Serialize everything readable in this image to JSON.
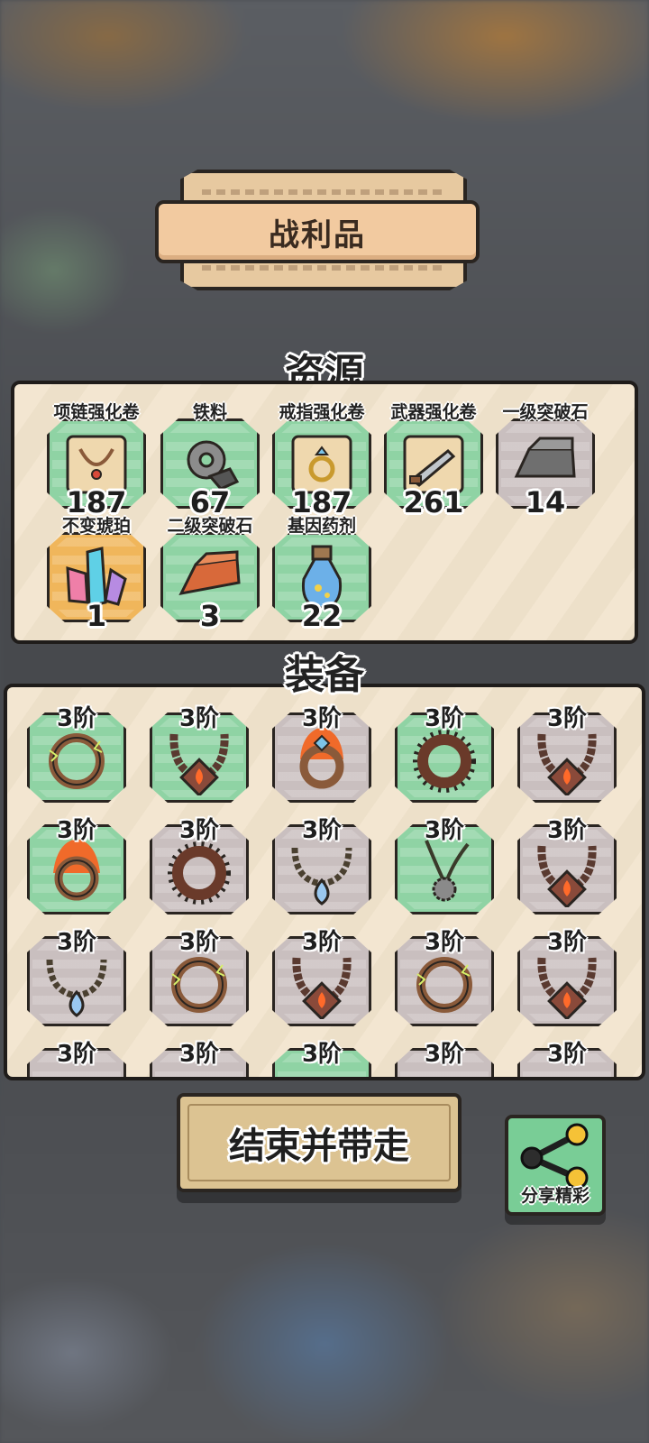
{
  "title": "战利品",
  "resources": {
    "title": "资源",
    "items": [
      {
        "name": "项链强化卷",
        "count": "187",
        "bg": "green",
        "icon": "necklace-scroll-icon"
      },
      {
        "name": "铁料",
        "count": "67",
        "bg": "green",
        "icon": "gear-ore-icon"
      },
      {
        "name": "戒指强化卷",
        "count": "187",
        "bg": "green",
        "icon": "ring-scroll-icon"
      },
      {
        "name": "武器强化卷",
        "count": "261",
        "bg": "green",
        "icon": "weapon-scroll-icon"
      },
      {
        "name": "一级突破石",
        "count": "14",
        "bg": "grey",
        "icon": "silver-ingot-icon"
      },
      {
        "name": "不变琥珀",
        "count": "1",
        "bg": "orange",
        "icon": "amber-crystal-icon"
      },
      {
        "name": "二级突破石",
        "count": "3",
        "bg": "green",
        "icon": "copper-ingot-icon"
      },
      {
        "name": "基因药剂",
        "count": "22",
        "bg": "green",
        "icon": "potion-icon"
      }
    ]
  },
  "equipment": {
    "title": "装备",
    "items": [
      {
        "tier": "3阶",
        "bg": "green",
        "icon": "lightning-ring-icon"
      },
      {
        "tier": "3阶",
        "bg": "green",
        "icon": "fire-bead-necklace-icon"
      },
      {
        "tier": "3阶",
        "bg": "grey",
        "icon": "flame-gem-ring-icon"
      },
      {
        "tier": "3阶",
        "bg": "green",
        "icon": "spiked-ring-icon"
      },
      {
        "tier": "3阶",
        "bg": "grey",
        "icon": "fire-bead-necklace-icon"
      },
      {
        "tier": "3阶",
        "bg": "green",
        "icon": "flame-ring-icon"
      },
      {
        "tier": "3阶",
        "bg": "grey",
        "icon": "spiked-ring-icon"
      },
      {
        "tier": "3阶",
        "bg": "grey",
        "icon": "water-drop-necklace-icon"
      },
      {
        "tier": "3阶",
        "bg": "green",
        "icon": "sawblade-pendant-icon"
      },
      {
        "tier": "3阶",
        "bg": "grey",
        "icon": "fire-bead-necklace-icon"
      },
      {
        "tier": "3阶",
        "bg": "grey",
        "icon": "water-drop-necklace-icon"
      },
      {
        "tier": "3阶",
        "bg": "grey",
        "icon": "lightning-ring-icon"
      },
      {
        "tier": "3阶",
        "bg": "grey",
        "icon": "fire-bead-necklace-icon"
      },
      {
        "tier": "3阶",
        "bg": "grey",
        "icon": "lightning-ring-icon"
      },
      {
        "tier": "3阶",
        "bg": "grey",
        "icon": "fire-bead-necklace-icon"
      },
      {
        "tier": "3阶",
        "bg": "grey",
        "icon": "ring-icon"
      },
      {
        "tier": "3阶",
        "bg": "grey",
        "icon": "ring-icon"
      },
      {
        "tier": "3阶",
        "bg": "green",
        "icon": "ring-icon"
      },
      {
        "tier": "3阶",
        "bg": "grey",
        "icon": "ring-icon"
      },
      {
        "tier": "3阶",
        "bg": "grey",
        "icon": "ring-icon"
      }
    ]
  },
  "buttons": {
    "end_label": "结束并带走",
    "share_label": "分享精彩"
  },
  "colors": {
    "tile_green": "#8fd3a4",
    "tile_grey": "#c9bfbf",
    "tile_orange": "#f0b65b",
    "panel_bg": "#f3e6d1",
    "banner_bg": "#f2caa0"
  }
}
